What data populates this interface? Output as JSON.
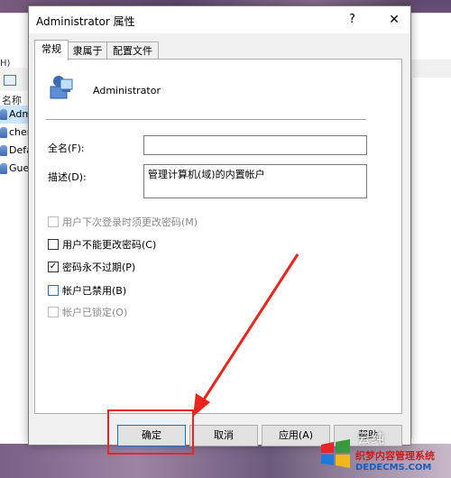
{
  "background_window": {
    "menu_fragment": "H)",
    "list_header": "名称",
    "users": [
      "Admi",
      "chen",
      "Defa",
      "Gues"
    ]
  },
  "dialog": {
    "title": "Administrator 属性",
    "help_glyph": "?",
    "close_glyph": "✕",
    "tabs": [
      {
        "label": "常规",
        "active": true
      },
      {
        "label": "隶属于",
        "active": false
      },
      {
        "label": "配置文件",
        "active": false
      }
    ],
    "user_name": "Administrator",
    "fields": {
      "fullname_label": "全名(F):",
      "fullname_value": "",
      "description_label": "描述(D):",
      "description_value": "管理计算机(域)的内置帐户"
    },
    "checkboxes": [
      {
        "label": "用户下次登录时须更改密码(M)",
        "checked": false,
        "enabled": false
      },
      {
        "label": "用户不能更改密码(C)",
        "checked": false,
        "enabled": true
      },
      {
        "label": "密码永不过期(P)",
        "checked": true,
        "enabled": true
      },
      {
        "label": "帐户已禁用(B)",
        "checked": false,
        "enabled": true
      },
      {
        "label": "帐户已锁定(O)",
        "checked": false,
        "enabled": false
      }
    ],
    "buttons": {
      "ok": "确定",
      "cancel": "取消",
      "apply": "应用(A)",
      "help": "帮助"
    }
  },
  "watermark": {
    "brand": "云纯",
    "line1": "织梦内容管理系统",
    "line2": "DEDECMS.COM"
  },
  "colors": {
    "annotation": "#e8261e",
    "accent": "#0078d7"
  }
}
